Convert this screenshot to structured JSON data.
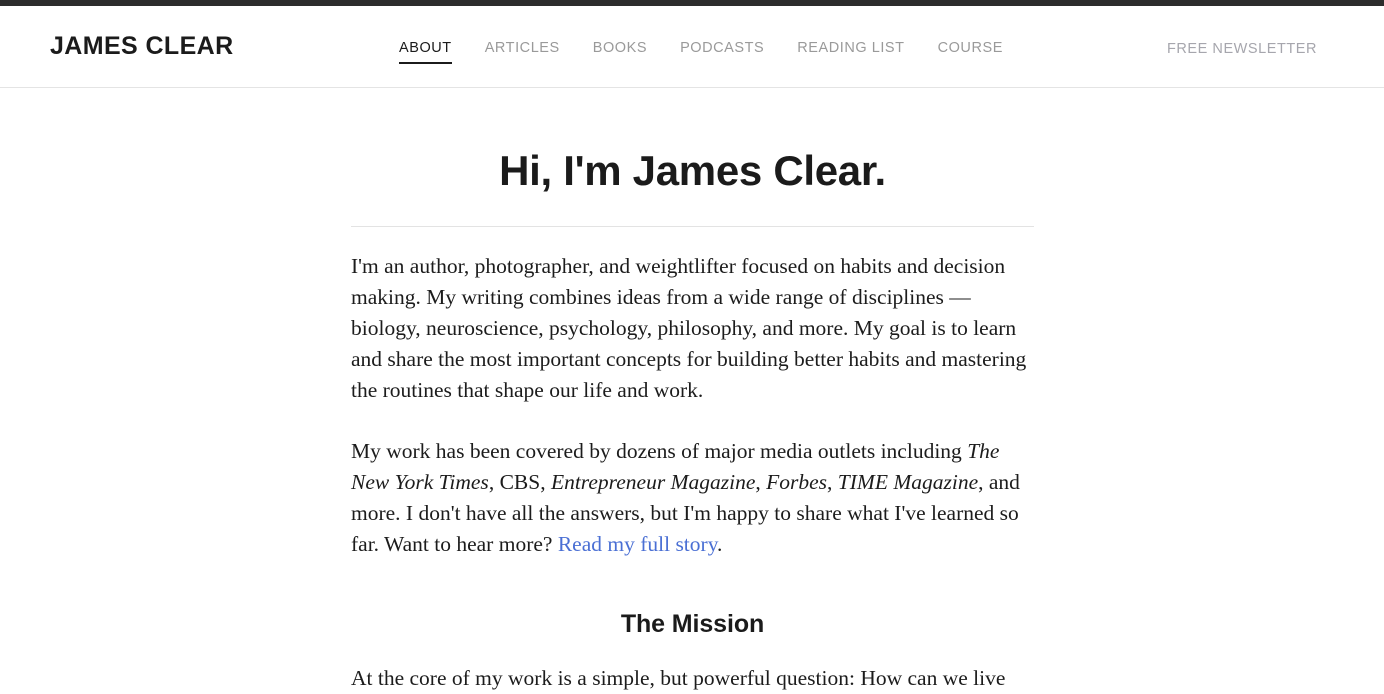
{
  "header": {
    "logo": "JAMES CLEAR",
    "nav": [
      {
        "label": "ABOUT",
        "active": true
      },
      {
        "label": "ARTICLES",
        "active": false
      },
      {
        "label": "BOOKS",
        "active": false
      },
      {
        "label": "PODCASTS",
        "active": false
      },
      {
        "label": "READING LIST",
        "active": false
      },
      {
        "label": "COURSE",
        "active": false
      }
    ],
    "secondary_nav": {
      "label": "FREE NEWSLETTER"
    }
  },
  "main": {
    "title": "Hi, I'm James Clear.",
    "paragraph1": {
      "text": "I'm an author, photographer, and weightlifter focused on habits and decision making. My writing combines ideas from a wide range of disciplines — biology, neuroscience, psychology, philosophy, and more. My goal is to learn and share the most important concepts for building better habits and mastering the routines that shape our life and work."
    },
    "paragraph2": {
      "part1": "My work has been covered by dozens of major media outlets including ",
      "media1": "The New York Times",
      "part2": ", CBS, ",
      "media2": "Entrepreneur Magazine",
      "part3": ", ",
      "media3": "Forbes",
      "part4": ", ",
      "media4": "TIME Magazine",
      "part5": ", and more. I don't have all the answers, but I'm happy to share what I've learned so far. Want to hear more? ",
      "link_text": "Read my full story",
      "part6": "."
    },
    "section": {
      "heading": "The Mission",
      "paragraph": "At the core of my work is a simple, but powerful question: How can we live"
    }
  },
  "colors": {
    "topbar": "#2c2c2c",
    "text": "#1c1c1c",
    "nav_inactive": "#9a9a9a",
    "link": "#4a6fd4",
    "rule": "#e3e3e3"
  }
}
